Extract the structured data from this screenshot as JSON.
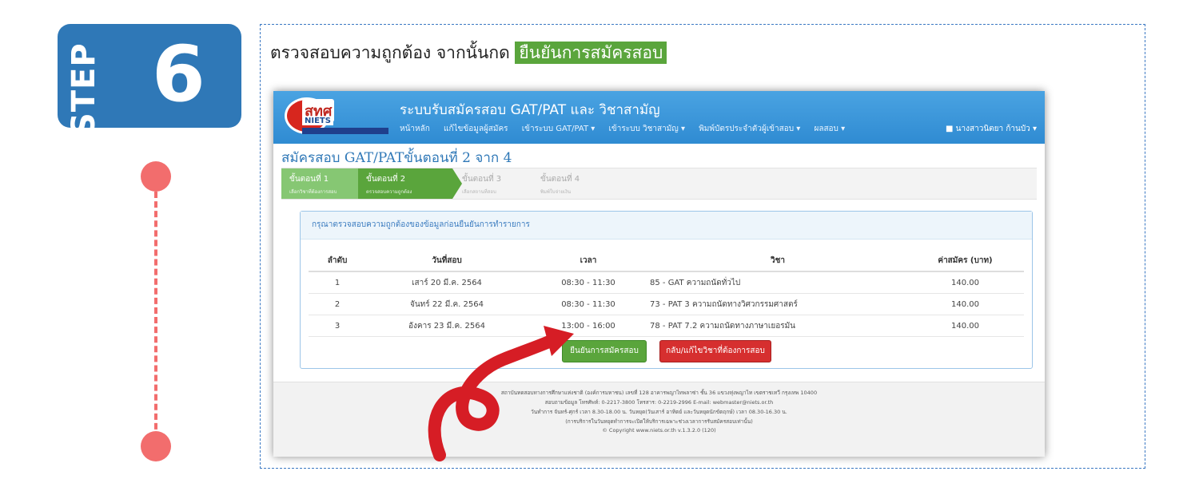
{
  "step_badge": {
    "word": "STEP",
    "number": "6"
  },
  "instruction": {
    "text": "ตรวจสอบความถูกต้อง จากนั้นกด ",
    "highlight": "ยืนยันการสมัครสอบ"
  },
  "app": {
    "logo": {
      "name": "สทศ",
      "sub": "NIETS"
    },
    "title": "ระบบรับสมัครสอบ GAT/PAT และ วิชาสามัญ",
    "nav": [
      "หน้าหลัก",
      "แก้ไขข้อมูลผู้สมัคร",
      "เข้าระบบ GAT/PAT ▾",
      "เข้าระบบ วิชาสามัญ ▾",
      "พิมพ์บัตรประจำตัวผู้เข้าสอบ ▾",
      "ผลสอบ ▾"
    ],
    "user": "นางสาวนิตยา ก้านบัว ▾",
    "page_heading": "สมัครสอบ GAT/PATขั้นตอนที่ 2 จาก 4",
    "steps": [
      {
        "label": "ขั้นตอนที่ 1",
        "sub": "เลือกวิชาที่ต้องการสอบ"
      },
      {
        "label": "ขั้นตอนที่ 2",
        "sub": "ตรวจสอบความถูกต้อง"
      },
      {
        "label": "ขั้นตอนที่ 3",
        "sub": "เลือกสถานที่สอบ"
      },
      {
        "label": "ขั้นตอนที่ 4",
        "sub": "พิมพ์ใบจ่ายเงิน"
      }
    ],
    "panel_heading": "กรุณาตรวจสอบความถูกต้องของข้อมูลก่อนยืนยันการทำรายการ",
    "table": {
      "headers": [
        "ลำดับ",
        "วันที่สอบ",
        "เวลา",
        "วิชา",
        "ค่าสมัคร (บาท)"
      ],
      "rows": [
        [
          "1",
          "เสาร์ 20 มี.ค. 2564",
          "08:30 - 11:30",
          "85 - GAT ความถนัดทั่วไป",
          "140.00"
        ],
        [
          "2",
          "จันทร์ 22 มี.ค. 2564",
          "08:30 - 11:30",
          "73 - PAT 3 ความถนัดทางวิศวกรรมศาสตร์",
          "140.00"
        ],
        [
          "3",
          "อังคาร 23 มี.ค. 2564",
          "13:00 - 16:00",
          "78 - PAT 7.2 ความถนัดทางภาษาเยอรมัน",
          "140.00"
        ]
      ]
    },
    "confirm_button": "ยืนยันการสมัครสอบ",
    "back_button": "กลับ/แก้ไขวิชาที่ต้องการสอบ",
    "footer": [
      "สถาบันทดสอบทางการศึกษาแห่งชาติ (องค์การมหาชน) เลขที่ 128 อาคารพญาไทพลาซ่า ชั้น 36 แขวงทุ่งพญาไท เขตราชเทวี กรุงเทพ 10400",
      "สอบถามข้อมูล โทรศัพท์: 0-2217-3800 โทรสาร: 0-2219-2996 E-mail: webmaster@niets.or.th",
      "วันทำการ จันทร์-ศุกร์ เวลา 8.30-18.00 น. วันหยุด(วันเสาร์ อาทิตย์ และวันหยุดนักขัตฤกษ์) เวลา 08.30-16.30 น.",
      "(การบริการในวันหยุดทำการจะเปิดให้บริการเฉพาะช่วงเวลาการรับสมัครสอบเท่านั้น)",
      "© Copyright www.niets.or.th v.1.3.2.0 (120)"
    ]
  },
  "colors": {
    "badge": "#2f78b7",
    "timeline": "#f26d6d",
    "highlight": "#5aa53c",
    "arrow": "#d61d25"
  }
}
